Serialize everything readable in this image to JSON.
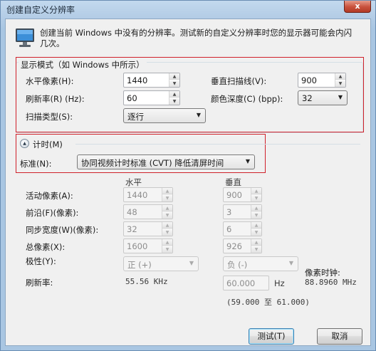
{
  "window": {
    "title": "创建自定义分辨率",
    "close_label": "x"
  },
  "intro": {
    "icon": "monitor-icon",
    "text": "创建当前 Windows 中没有的分辨率。测试新的自定义分辨率时您的显示器可能会内闪几次。"
  },
  "display_mode": {
    "legend": "显示模式（如 Windows 中所示）",
    "h_pixels_label": "水平像素(H):",
    "h_pixels_value": "1440",
    "v_lines_label": "垂直扫描线(V):",
    "v_lines_value": "900",
    "refresh_label": "刷新率(R) (Hz):",
    "refresh_value": "60",
    "color_depth_label": "颜色深度(C) (bpp):",
    "color_depth_value": "32",
    "scan_type_label": "扫描类型(S):",
    "scan_type_value": "逐行"
  },
  "timing": {
    "toggle_label": "计时(M)",
    "standard_label": "标准(N):",
    "standard_value": "协同视频计时标准 (CVT) 降低清屏时间",
    "col_horizontal": "水平",
    "col_vertical": "垂直",
    "active_label": "活动像素(A):",
    "active_h": "1440",
    "active_v": "900",
    "front_porch_label": "前沿(F)(像素):",
    "front_porch_h": "48",
    "front_porch_v": "3",
    "sync_width_label": "同步宽度(W)(像素):",
    "sync_width_h": "32",
    "sync_width_v": "6",
    "total_label": "总像素(X):",
    "total_h": "1600",
    "total_v": "926",
    "polarity_label": "极性(Y):",
    "polarity_h": "正 (+)",
    "polarity_v": "负 (-)",
    "refresh_label": "刷新率:",
    "refresh_h": "55.56 KHz",
    "refresh_v_value": "60.000",
    "refresh_v_unit": "Hz",
    "refresh_range": "(59.000 至 61.000)",
    "pixel_clock_label": "像素时钟:",
    "pixel_clock_value": "88.8960 MHz"
  },
  "buttons": {
    "test": "测试(T)",
    "cancel": "取消"
  },
  "colors": {
    "highlight_border": "#d0202a",
    "window_frame": "#a9c6e2"
  }
}
